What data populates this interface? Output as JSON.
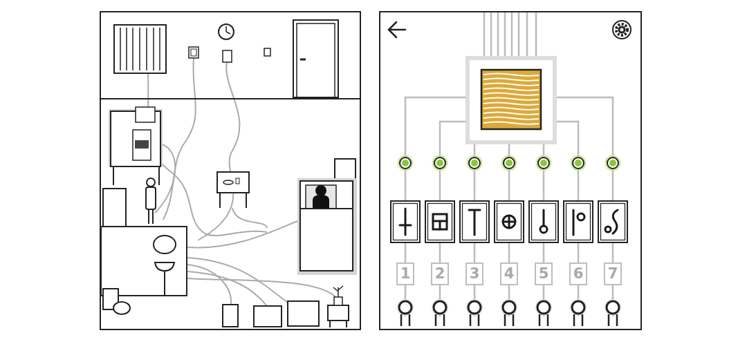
{
  "screen": {
    "lit": true
  },
  "channels": [
    {
      "number": "1",
      "kind": "dagger",
      "lit": true,
      "on": false
    },
    {
      "number": "2",
      "kind": "grid",
      "lit": true,
      "on": false
    },
    {
      "number": "3",
      "kind": "tee",
      "lit": true,
      "on": false
    },
    {
      "number": "4",
      "kind": "target",
      "lit": true,
      "on": false
    },
    {
      "number": "5",
      "kind": "pendant",
      "lit": true,
      "on": false
    },
    {
      "number": "6",
      "kind": "flag",
      "lit": true,
      "on": false
    },
    {
      "number": "7",
      "kind": "hook",
      "lit": true,
      "on": false
    }
  ]
}
